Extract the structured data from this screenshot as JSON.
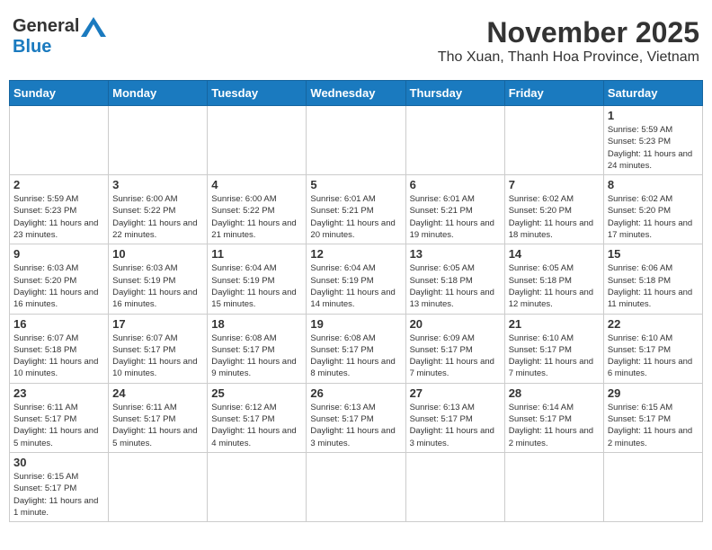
{
  "header": {
    "logo_general": "General",
    "logo_blue": "Blue",
    "month": "November 2025",
    "location": "Tho Xuan, Thanh Hoa Province, Vietnam"
  },
  "days_of_week": [
    "Sunday",
    "Monday",
    "Tuesday",
    "Wednesday",
    "Thursday",
    "Friday",
    "Saturday"
  ],
  "weeks": [
    [
      {
        "day": "",
        "info": ""
      },
      {
        "day": "",
        "info": ""
      },
      {
        "day": "",
        "info": ""
      },
      {
        "day": "",
        "info": ""
      },
      {
        "day": "",
        "info": ""
      },
      {
        "day": "",
        "info": ""
      },
      {
        "day": "1",
        "info": "Sunrise: 5:59 AM\nSunset: 5:23 PM\nDaylight: 11 hours and 24 minutes."
      }
    ],
    [
      {
        "day": "2",
        "info": "Sunrise: 5:59 AM\nSunset: 5:23 PM\nDaylight: 11 hours and 23 minutes."
      },
      {
        "day": "3",
        "info": "Sunrise: 6:00 AM\nSunset: 5:22 PM\nDaylight: 11 hours and 22 minutes."
      },
      {
        "day": "4",
        "info": "Sunrise: 6:00 AM\nSunset: 5:22 PM\nDaylight: 11 hours and 21 minutes."
      },
      {
        "day": "5",
        "info": "Sunrise: 6:01 AM\nSunset: 5:21 PM\nDaylight: 11 hours and 20 minutes."
      },
      {
        "day": "6",
        "info": "Sunrise: 6:01 AM\nSunset: 5:21 PM\nDaylight: 11 hours and 19 minutes."
      },
      {
        "day": "7",
        "info": "Sunrise: 6:02 AM\nSunset: 5:20 PM\nDaylight: 11 hours and 18 minutes."
      },
      {
        "day": "8",
        "info": "Sunrise: 6:02 AM\nSunset: 5:20 PM\nDaylight: 11 hours and 17 minutes."
      }
    ],
    [
      {
        "day": "9",
        "info": "Sunrise: 6:03 AM\nSunset: 5:20 PM\nDaylight: 11 hours and 16 minutes."
      },
      {
        "day": "10",
        "info": "Sunrise: 6:03 AM\nSunset: 5:19 PM\nDaylight: 11 hours and 16 minutes."
      },
      {
        "day": "11",
        "info": "Sunrise: 6:04 AM\nSunset: 5:19 PM\nDaylight: 11 hours and 15 minutes."
      },
      {
        "day": "12",
        "info": "Sunrise: 6:04 AM\nSunset: 5:19 PM\nDaylight: 11 hours and 14 minutes."
      },
      {
        "day": "13",
        "info": "Sunrise: 6:05 AM\nSunset: 5:18 PM\nDaylight: 11 hours and 13 minutes."
      },
      {
        "day": "14",
        "info": "Sunrise: 6:05 AM\nSunset: 5:18 PM\nDaylight: 11 hours and 12 minutes."
      },
      {
        "day": "15",
        "info": "Sunrise: 6:06 AM\nSunset: 5:18 PM\nDaylight: 11 hours and 11 minutes."
      }
    ],
    [
      {
        "day": "16",
        "info": "Sunrise: 6:07 AM\nSunset: 5:18 PM\nDaylight: 11 hours and 10 minutes."
      },
      {
        "day": "17",
        "info": "Sunrise: 6:07 AM\nSunset: 5:17 PM\nDaylight: 11 hours and 10 minutes."
      },
      {
        "day": "18",
        "info": "Sunrise: 6:08 AM\nSunset: 5:17 PM\nDaylight: 11 hours and 9 minutes."
      },
      {
        "day": "19",
        "info": "Sunrise: 6:08 AM\nSunset: 5:17 PM\nDaylight: 11 hours and 8 minutes."
      },
      {
        "day": "20",
        "info": "Sunrise: 6:09 AM\nSunset: 5:17 PM\nDaylight: 11 hours and 7 minutes."
      },
      {
        "day": "21",
        "info": "Sunrise: 6:10 AM\nSunset: 5:17 PM\nDaylight: 11 hours and 7 minutes."
      },
      {
        "day": "22",
        "info": "Sunrise: 6:10 AM\nSunset: 5:17 PM\nDaylight: 11 hours and 6 minutes."
      }
    ],
    [
      {
        "day": "23",
        "info": "Sunrise: 6:11 AM\nSunset: 5:17 PM\nDaylight: 11 hours and 5 minutes."
      },
      {
        "day": "24",
        "info": "Sunrise: 6:11 AM\nSunset: 5:17 PM\nDaylight: 11 hours and 5 minutes."
      },
      {
        "day": "25",
        "info": "Sunrise: 6:12 AM\nSunset: 5:17 PM\nDaylight: 11 hours and 4 minutes."
      },
      {
        "day": "26",
        "info": "Sunrise: 6:13 AM\nSunset: 5:17 PM\nDaylight: 11 hours and 3 minutes."
      },
      {
        "day": "27",
        "info": "Sunrise: 6:13 AM\nSunset: 5:17 PM\nDaylight: 11 hours and 3 minutes."
      },
      {
        "day": "28",
        "info": "Sunrise: 6:14 AM\nSunset: 5:17 PM\nDaylight: 11 hours and 2 minutes."
      },
      {
        "day": "29",
        "info": "Sunrise: 6:15 AM\nSunset: 5:17 PM\nDaylight: 11 hours and 2 minutes."
      }
    ],
    [
      {
        "day": "30",
        "info": "Sunrise: 6:15 AM\nSunset: 5:17 PM\nDaylight: 11 hours and 1 minute."
      },
      {
        "day": "",
        "info": ""
      },
      {
        "day": "",
        "info": ""
      },
      {
        "day": "",
        "info": ""
      },
      {
        "day": "",
        "info": ""
      },
      {
        "day": "",
        "info": ""
      },
      {
        "day": "",
        "info": ""
      }
    ]
  ]
}
